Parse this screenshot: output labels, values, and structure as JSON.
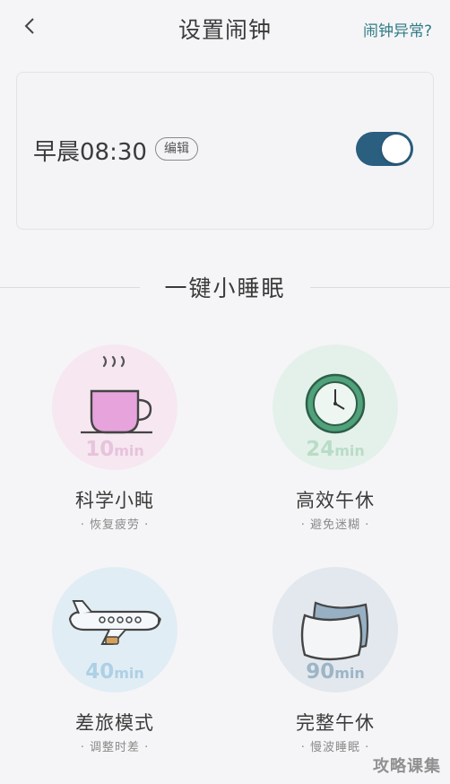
{
  "header": {
    "title": "设置闹钟",
    "help_link": "闹钟异常?"
  },
  "alarm": {
    "time_label": "早晨08:30",
    "edit_label": "编辑",
    "enabled": true
  },
  "section": {
    "title": "一键小睡眠"
  },
  "naps": [
    {
      "name": "科学小盹",
      "desc": "· 恢复疲劳 ·",
      "duration": "10",
      "unit": "min",
      "icon": "coffee-cup-icon",
      "circle_color": "#f6e7f1",
      "duration_color": "#e7c3dc"
    },
    {
      "name": "高效午休",
      "desc": "· 避免迷糊 ·",
      "duration": "24",
      "unit": "min",
      "icon": "clock-icon",
      "circle_color": "#e4f1ea",
      "duration_color": "#b9dcc6"
    },
    {
      "name": "差旅模式",
      "desc": "· 调整时差 ·",
      "duration": "40",
      "unit": "min",
      "icon": "airplane-icon",
      "circle_color": "#e1edf4",
      "duration_color": "#aed0e5"
    },
    {
      "name": "完整午休",
      "desc": "· 慢波睡眠 ·",
      "duration": "90",
      "unit": "min",
      "icon": "pillow-icon",
      "circle_color": "#e2e8ed",
      "duration_color": "#9db5c6"
    }
  ],
  "watermark": "攻略课集"
}
